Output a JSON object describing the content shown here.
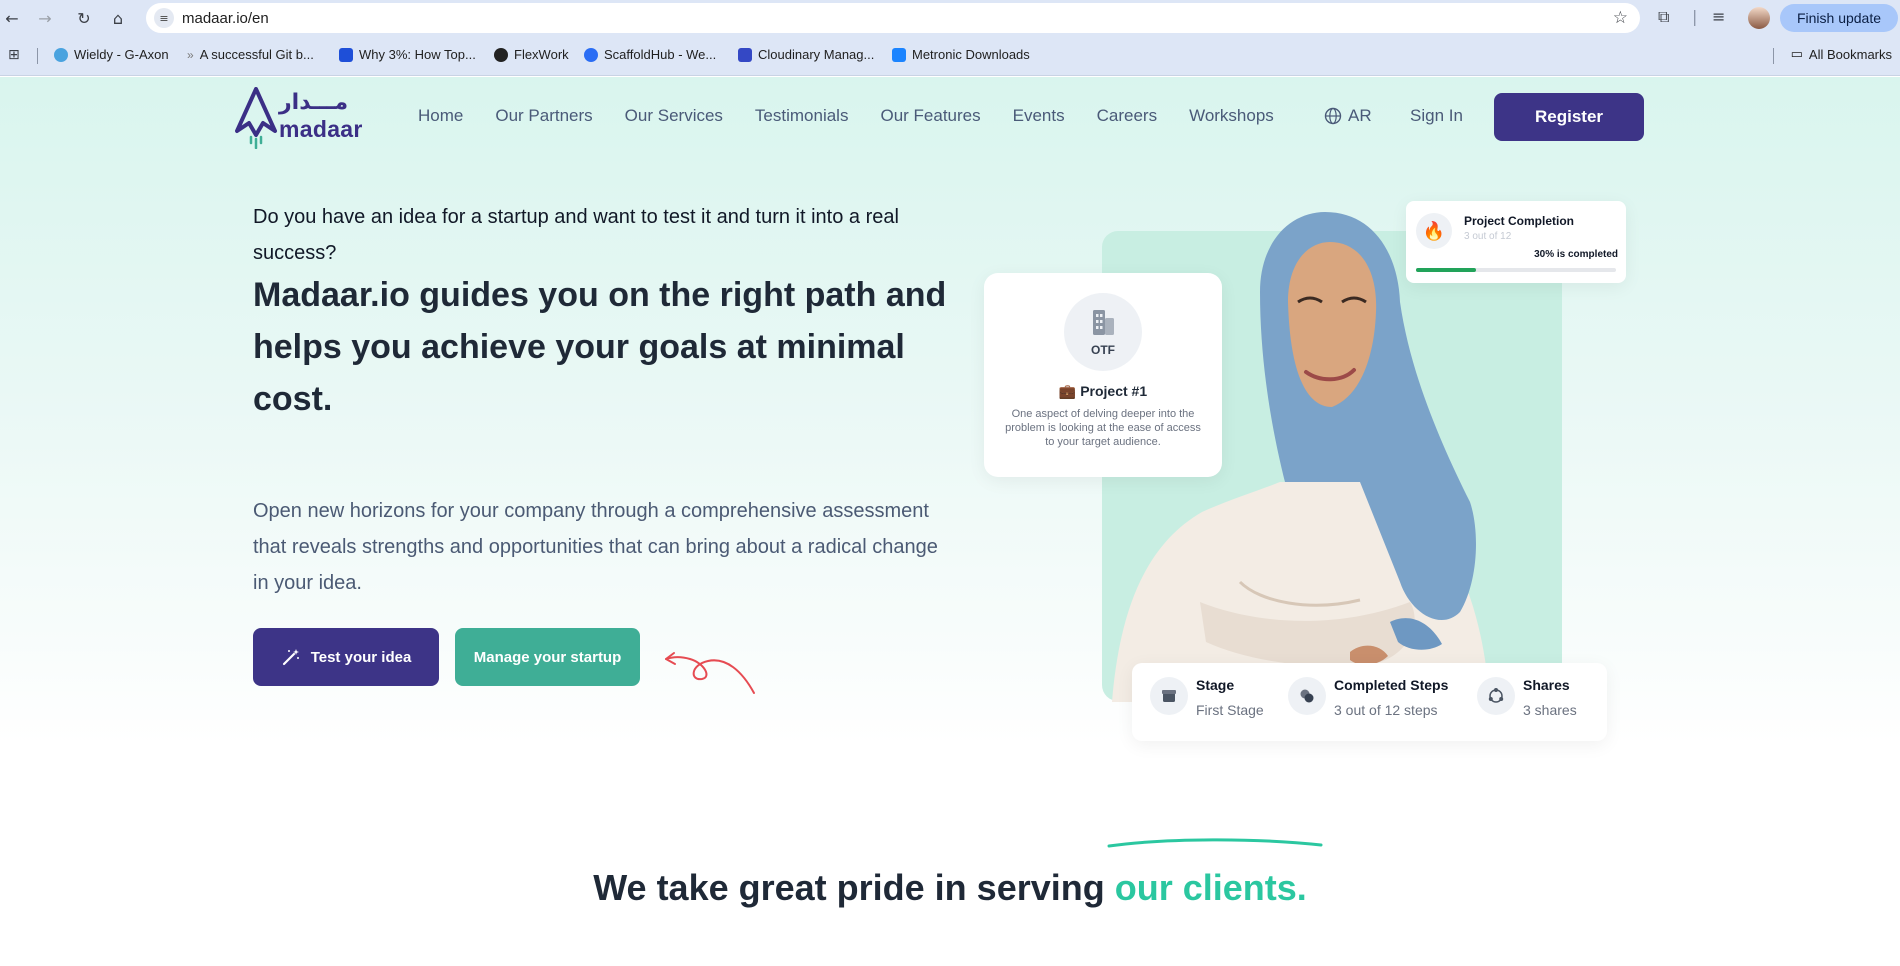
{
  "browser": {
    "url": "madaar.io/en",
    "finish_update_label": "Finish update",
    "bookmarks": [
      {
        "label": "Wieldy - G-Axon",
        "color": "#4aa3df"
      },
      {
        "label": "A successful Git b...",
        "color": "#7a7a7a"
      },
      {
        "label": "Why 3%: How Top...",
        "color": "#1e4fd8"
      },
      {
        "label": "FlexWork",
        "color": "#222222"
      },
      {
        "label": "ScaffoldHub - We...",
        "color": "#2a6df4"
      },
      {
        "label": "Cloudinary Manag...",
        "color": "#3448c5"
      },
      {
        "label": "Metronic Downloads",
        "color": "#1b84ff"
      }
    ],
    "all_bookmarks_label": "All Bookmarks"
  },
  "header": {
    "logo_ar": "مـــدار",
    "logo_en": "madaar",
    "nav": [
      "Home",
      "Our Partners",
      "Our Services",
      "Testimonials",
      "Our Features",
      "Events",
      "Careers",
      "Workshops"
    ],
    "lang_label": "AR",
    "signin_label": "Sign In",
    "register_label": "Register"
  },
  "hero": {
    "question": "Do you have an idea for a startup and want to test it and turn it into a real success?",
    "headline": "Madaar.io guides you on the right path and helps you achieve your goals at minimal cost.",
    "paragraph": "Open new horizons for your company through a comprehensive assessment that reveals strengths and opportunities that can bring about a radical change in your idea.",
    "test_button": "Test your idea",
    "manage_button": "Manage your startup"
  },
  "project_card": {
    "badge": "OTF",
    "title": "💼 Project #1",
    "description": "One aspect of delving deeper into the problem is looking at the ease of access to your target audience."
  },
  "completion_card": {
    "title": "Project Completion",
    "subtitle": "3 out of 12",
    "percent_label": "30% is completed",
    "progress": 0.3
  },
  "stats": [
    {
      "label": "Stage",
      "value": "First Stage",
      "icon": "stage-icon"
    },
    {
      "label": "Completed Steps",
      "value": "3 out of 12 steps",
      "icon": "steps-icon"
    },
    {
      "label": "Shares",
      "value": "3 shares",
      "icon": "shares-icon"
    }
  ],
  "clients": {
    "heading_main": "We take great pride in serving ",
    "heading_accent": "our clients."
  },
  "colors": {
    "primary": "#3d3487",
    "accent": "#3fae96",
    "highlight": "#2bc7a0",
    "arrow": "#e64b52"
  }
}
